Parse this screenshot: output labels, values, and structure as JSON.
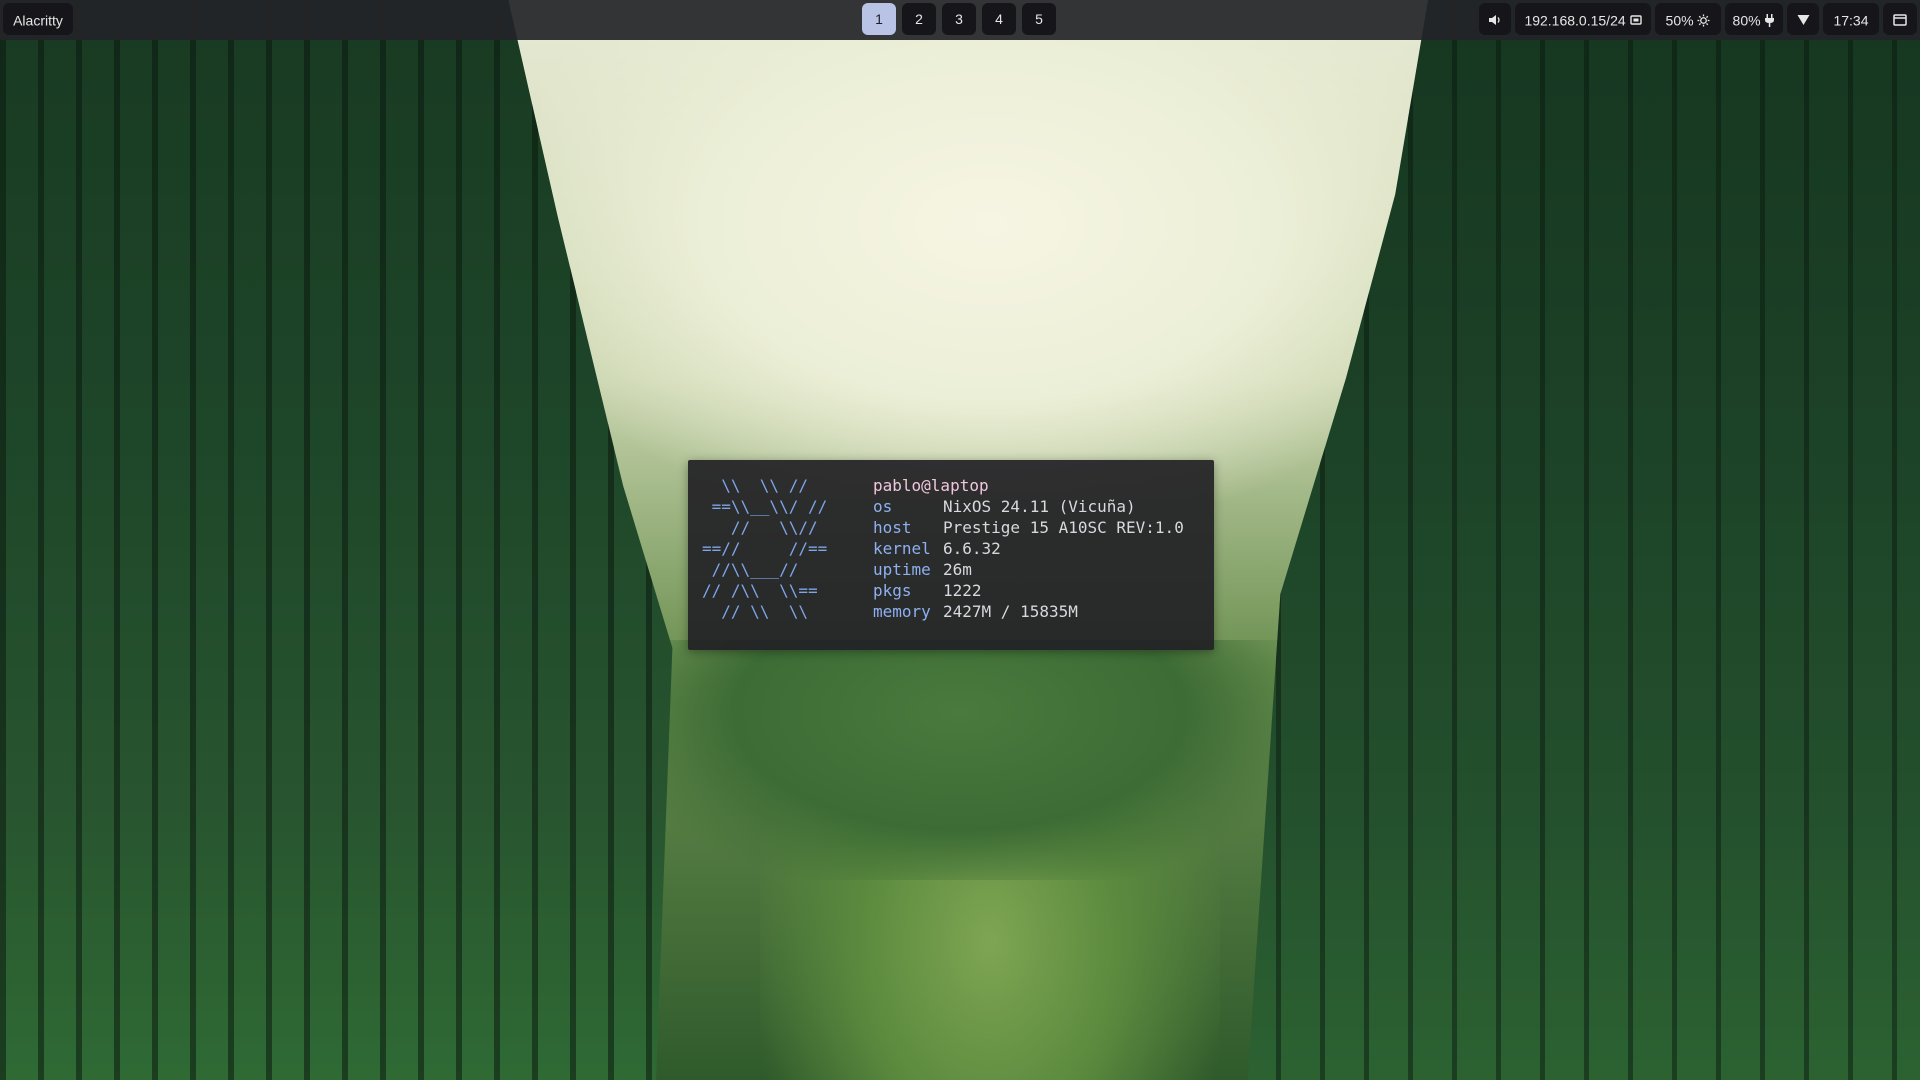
{
  "topbar": {
    "window_title": "Alacritty",
    "workspaces": [
      {
        "label": "1",
        "active": true
      },
      {
        "label": "2",
        "active": false
      },
      {
        "label": "3",
        "active": false
      },
      {
        "label": "4",
        "active": false
      },
      {
        "label": "5",
        "active": false
      }
    ],
    "volume_icon": "speaker-icon",
    "network": "192.168.0.15/24",
    "network_icon": "ethernet-icon",
    "brightness": "50%",
    "brightness_icon": "sun-gear-icon",
    "battery": "80%",
    "battery_icon": "plug-icon",
    "wifi_icon": "wifi-triangle-icon",
    "clock": "17:34",
    "notification_icon": "notification-panel-icon"
  },
  "terminal": {
    "ascii_logo": "  \\\\  \\\\ //\n ==\\\\__\\\\/ //\n   //   \\\\//\n==//     //==\n //\\\\___//\n// /\\\\  \\\\==\n  // \\\\  \\\\",
    "user_host": "pablo@laptop",
    "rows": [
      {
        "key": "os",
        "value": "NixOS 24.11 (Vicuña)"
      },
      {
        "key": "host",
        "value": "Prestige 15 A10SC REV:1.0"
      },
      {
        "key": "kernel",
        "value": "6.6.32"
      },
      {
        "key": "uptime",
        "value": "26m"
      },
      {
        "key": "pkgs",
        "value": "1222"
      },
      {
        "key": "memory",
        "value": "2427M / 15835M"
      }
    ]
  },
  "colors": {
    "bar_background": "#242428",
    "pill_background": "#16161a",
    "active_workspace": "#b9c3e6",
    "ascii_logo": "#7fa4e8",
    "info_key": "#8fb0f0",
    "user_host": "#f0c6dd"
  }
}
